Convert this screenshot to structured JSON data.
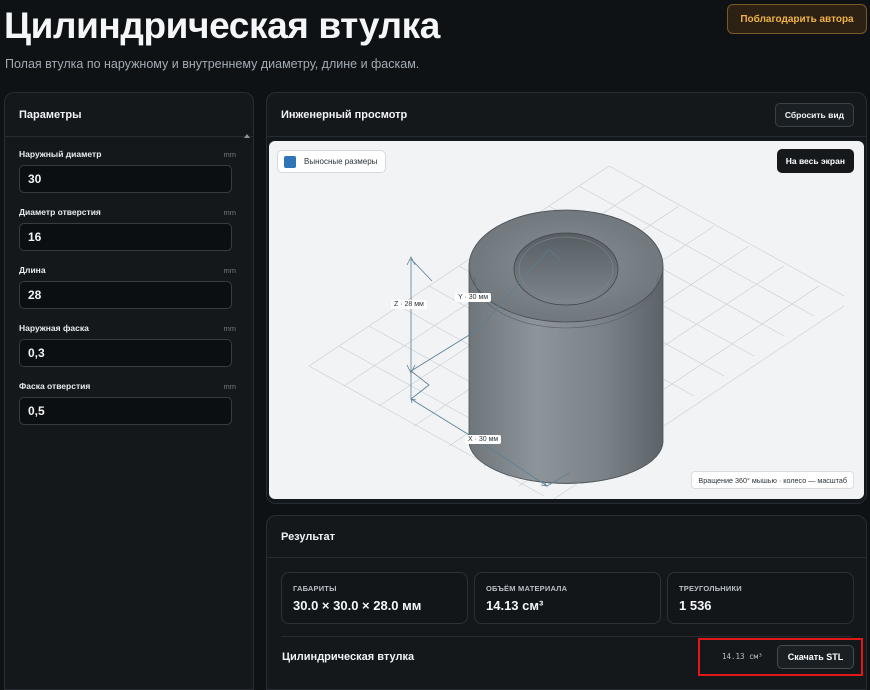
{
  "header": {
    "title": "Цилиндрическая втулка",
    "subtitle": "Полая втулка по наружному и внутреннему диаметру, длине и фаскам.",
    "thanks_label": "Поблагодарить автора"
  },
  "params": {
    "title": "Параметры",
    "fields": [
      {
        "label": "Наружный диаметр",
        "unit": "mm",
        "value": "30"
      },
      {
        "label": "Диаметр отверстия",
        "unit": "mm",
        "value": "16"
      },
      {
        "label": "Длина",
        "unit": "mm",
        "value": "28"
      },
      {
        "label": "Наружная фаска",
        "unit": "mm",
        "value": "0,3"
      },
      {
        "label": "Фаска отверстия",
        "unit": "mm",
        "value": "0,5"
      }
    ]
  },
  "viewer": {
    "title": "Инженерный просмотр",
    "reset_label": "Сбросить вид",
    "dims_toggle_label": "Выносные размеры",
    "dims_checked": true,
    "fullscreen_label": "На весь экран",
    "hint": "Вращение 360° мышью · колесо — масштаб",
    "dim_x": "X · 30 мм",
    "dim_y": "Y · 30 мм",
    "dim_z": "Z · 28 мм"
  },
  "result": {
    "title": "Результат",
    "stats": [
      {
        "label": "ГАБАРИТЫ",
        "value": "30.0 × 30.0 × 28.0 мм"
      },
      {
        "label": "ОБЪЁМ МАТЕРИАЛА",
        "value": "14.13 см³"
      },
      {
        "label": "ТРЕУГОЛЬНИКИ",
        "value": "1 536"
      }
    ],
    "name": "Цилиндрическая втулка",
    "volume_short": "14.13 см³",
    "download_label": "Скачать STL"
  },
  "colors": {
    "accent": "#f0b249",
    "checkbox": "#2f73b8",
    "highlight": "#e01818"
  }
}
